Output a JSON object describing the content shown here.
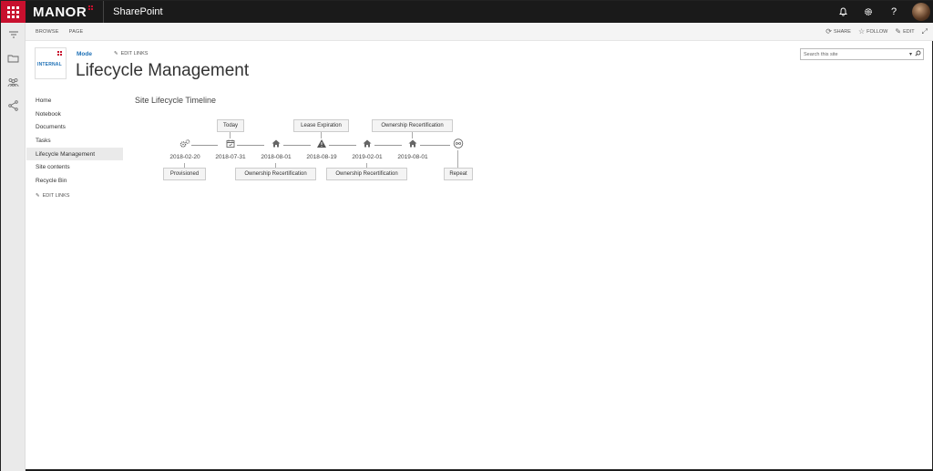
{
  "suite": {
    "brand": "MANOR",
    "app_title": "SharePoint",
    "icons": [
      "bell-icon",
      "gear-icon",
      "help-icon"
    ],
    "help_glyph": "?"
  },
  "ribbon": {
    "tabs": [
      "BROWSE",
      "PAGE"
    ],
    "actions": [
      {
        "label": "SHARE",
        "icon": "share-icon"
      },
      {
        "label": "FOLLOW",
        "icon": "star-icon"
      },
      {
        "label": "EDIT",
        "icon": "pencil-icon"
      }
    ]
  },
  "header": {
    "logo_text": "INTERNAL",
    "mode_link": "Mode",
    "edit_links": "EDIT LINKS",
    "title": "Lifecycle Management",
    "search_placeholder": "Search this site"
  },
  "nav": {
    "items": [
      "Home",
      "Notebook",
      "Documents",
      "Tasks",
      "Lifecycle Management",
      "Site contents",
      "Recycle Bin"
    ],
    "selected": "Lifecycle Management",
    "edit_links": "EDIT LINKS"
  },
  "timeline": {
    "title": "Site Lifecycle Timeline",
    "nodes": [
      {
        "date": "2018-02-20",
        "icon": "gears-icon",
        "label": "Provisioned",
        "label_pos": "below"
      },
      {
        "date": "2018-07-31",
        "icon": "calendar-icon",
        "label": "Today",
        "label_pos": "above"
      },
      {
        "date": "2018-08-01",
        "icon": "home-icon",
        "label": "Ownership Recertification",
        "label_pos": "below"
      },
      {
        "date": "2018-08-19",
        "icon": "warning-icon",
        "label": "Lease Expiration",
        "label_pos": "above"
      },
      {
        "date": "2019-02-01",
        "icon": "home-icon",
        "label": "Ownership Recertification",
        "label_pos": "below"
      },
      {
        "date": "2019-08-01",
        "icon": "home-icon",
        "label": "Ownership Recertification",
        "label_pos": "above"
      },
      {
        "date": "",
        "icon": "infinity-icon",
        "label": "Repeat",
        "label_pos": "below"
      }
    ]
  }
}
